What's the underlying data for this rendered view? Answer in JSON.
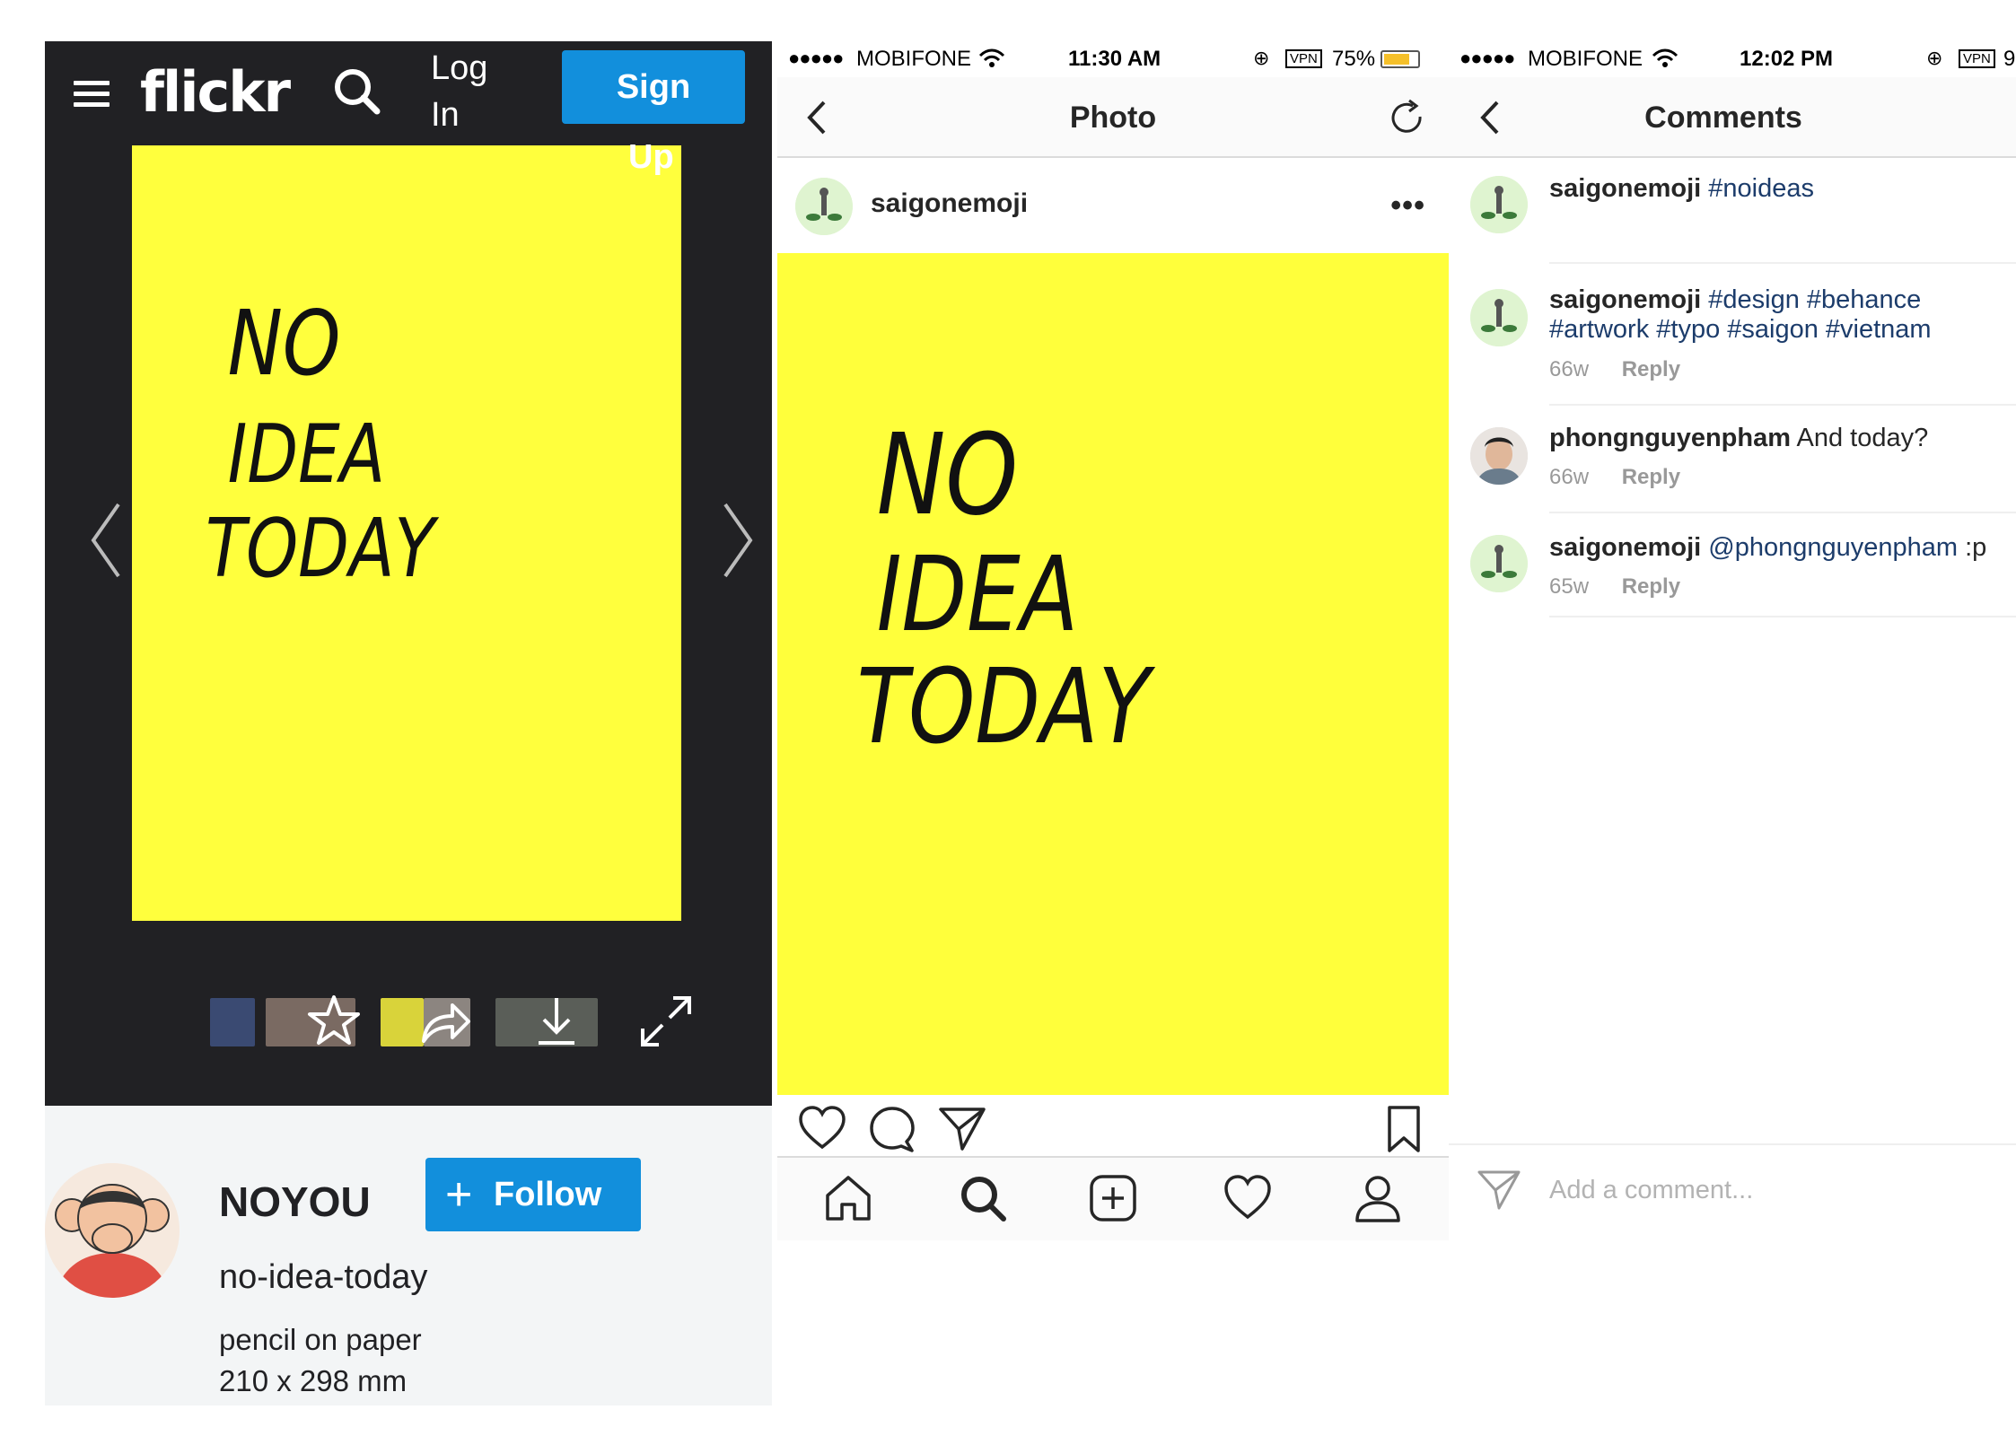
{
  "flickr": {
    "logo": "flickr",
    "login_label": "Log In",
    "signup_label": "Sign",
    "signup_overflow": "Up",
    "photo_text": [
      "NO",
      "IDEA",
      "TODAY"
    ],
    "follow_label": "Follow",
    "owner": "NOYOU",
    "photo_title": "no-idea-today",
    "description_line1": "pencil on paper",
    "description_line2": "210 x 298 mm",
    "colors": {
      "header": "#212124",
      "accent": "#128fdc",
      "photo": "#ffff3d"
    },
    "icons": [
      "menu-icon",
      "search-icon",
      "chevron-left-icon",
      "chevron-right-icon",
      "star-icon",
      "share-icon",
      "download-icon",
      "expand-icon"
    ]
  },
  "instagram_photo": {
    "status": {
      "dots": "●●●●●",
      "carrier": "MOBIFONE",
      "time": "11:30 AM",
      "vpn": "VPN",
      "battery": "75%"
    },
    "nav_title": "Photo",
    "username": "saigonemoji",
    "more": "•••",
    "photo_text": [
      "NO",
      "IDEA",
      "TODAY"
    ],
    "colors": {
      "photo": "#ffff3b"
    },
    "icons": [
      "back-chevron-icon",
      "refresh-icon",
      "heart-icon",
      "comment-icon",
      "send-icon",
      "bookmark-icon",
      "home-icon",
      "search-icon",
      "add-icon",
      "activity-heart-icon",
      "profile-icon"
    ]
  },
  "instagram_comments": {
    "status": {
      "dots": "●●●●●",
      "carrier": "MOBIFONE",
      "time": "12:02 PM",
      "vpn": "VPN",
      "battery": "9"
    },
    "nav_title": "Comments",
    "comments": [
      {
        "user": "saigonemoji",
        "text": "#noideas"
      },
      {
        "user": "saigonemoji",
        "text": "#design #behance #artwork #typo #saigon #vietnam",
        "age": "66w",
        "reply": "Reply"
      },
      {
        "user": "phongnguyenpham",
        "text": "And today?",
        "age": "66w",
        "reply": "Reply"
      },
      {
        "user": "saigonemoji",
        "mention": "@phongnguyenpham",
        "text": ":p",
        "age": "65w",
        "reply": "Reply"
      }
    ],
    "input_placeholder": "Add a comment...",
    "colors": {
      "hashtag": "#1c3c6b"
    }
  }
}
